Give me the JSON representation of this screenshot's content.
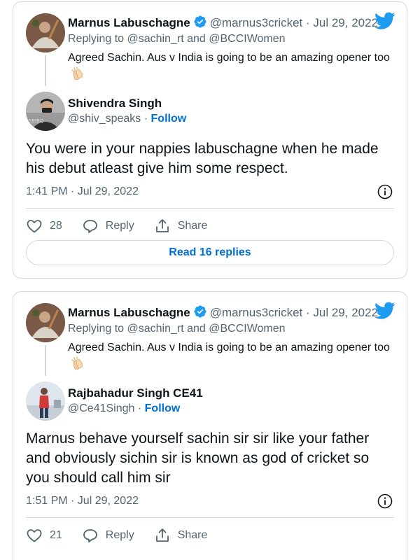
{
  "tweets": [
    {
      "parent": {
        "name": "Marnus Labuschagne",
        "handle": "@marnus3cricket",
        "date": "Jul 29, 2022",
        "replying_to": "Replying to @sachin_rt and @BCCIWomen",
        "text": "Agreed Sachin. Aus v India is going to be an amazing opener too",
        "emoji": "clapping-hands-icon"
      },
      "reply": {
        "name": "Shivendra Singh",
        "handle": "@shiv_speaks",
        "follow_label": "Follow",
        "text": "You were in your nappies labuschagne when he made his debut atleast give him some respect.",
        "time": "1:41 PM · Jul 29, 2022",
        "likes": "28",
        "reply_label": "Reply",
        "share_label": "Share",
        "read_replies_label": "Read 16 replies"
      }
    },
    {
      "parent": {
        "name": "Marnus Labuschagne",
        "handle": "@marnus3cricket",
        "date": "Jul 29, 2022",
        "replying_to": "Replying to @sachin_rt and @BCCIWomen",
        "text": "Agreed Sachin. Aus v India is going to be an amazing opener too",
        "emoji": "clapping-hands-icon"
      },
      "reply": {
        "name": "Rajbahadur Singh CE41",
        "handle": "@Ce41Singh",
        "follow_label": "Follow",
        "text": "Marnus behave yourself sachin sir sir like your father and obviously sichin sir is known as god of cricket so you should call him sir",
        "time": "1:51 PM · Jul 29, 2022",
        "likes": "21",
        "reply_label": "Reply",
        "share_label": "Share"
      }
    }
  ],
  "colors": {
    "accent": "#006fd6",
    "twitter_blue": "#1d9bf0",
    "muted_text": "#536471",
    "border": "#cfd9de"
  }
}
